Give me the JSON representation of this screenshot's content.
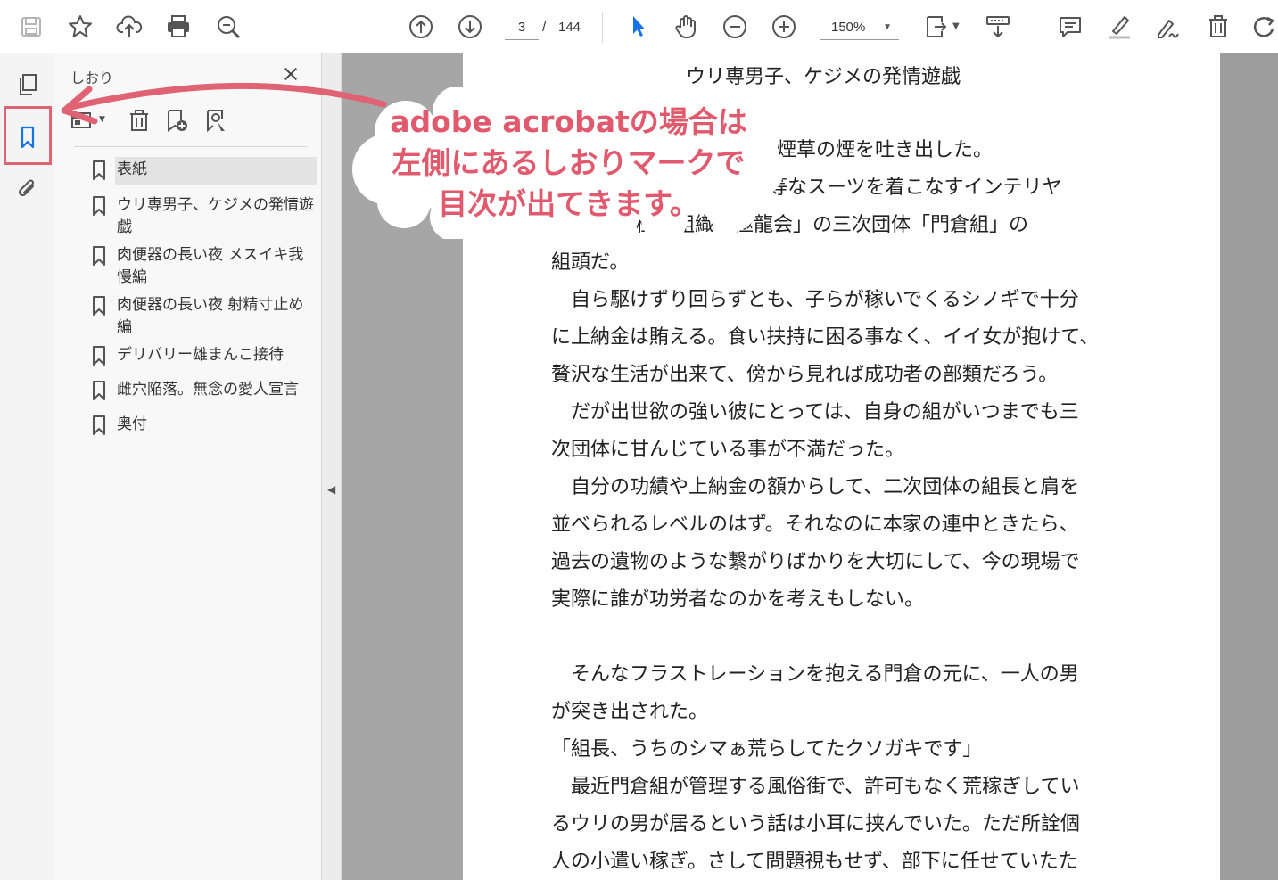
{
  "toolbar": {
    "current_page": "3",
    "page_separator": "/",
    "total_pages": "144",
    "zoom": "150%",
    "icons": [
      "save-icon",
      "star-icon",
      "upload-icon",
      "print-icon",
      "zoom-search-icon",
      "page-up-icon",
      "page-down-icon",
      "select-arrow-icon",
      "hand-icon",
      "zoom-out-icon",
      "zoom-in-icon",
      "fit-page-icon",
      "scroll-mode-icon",
      "comment-icon",
      "highlight-icon",
      "sign-icon",
      "delete-icon",
      "rotate-icon"
    ]
  },
  "bookmarks_panel": {
    "title": "しおり",
    "items": [
      {
        "label": "表紙",
        "selected": true
      },
      {
        "label": "ウリ専男子、ケジメの発情遊戯"
      },
      {
        "label": "肉便器の長い夜 メスイキ我慢編"
      },
      {
        "label": "肉便器の長い夜 射精寸止め編"
      },
      {
        "label": "デリバリー雄まんこ接待"
      },
      {
        "label": "雌穴陥落。無念の愛人宣言"
      },
      {
        "label": "奥付"
      }
    ]
  },
  "document": {
    "header": "ウリ専男子、ケジメの発情遊戯",
    "lines": [
      "煙草の煙を吐き出した。",
      "上等なスーツを着こなすインテリヤ",
      "極道組織「極龍会」の三次団体「門倉組」の",
      "組頭だ。",
      "　自ら駆けずり回らずとも、子らが稼いでくるシノギで十分",
      "に上納金は賄える。食い扶持に困る事なく、イイ女が抱けて、",
      "贅沢な生活が出来て、傍から見れば成功者の部類だろう。",
      "　だが出世欲の強い彼にとっては、自身の組がいつまでも三",
      "次団体に甘んじている事が不満だった。",
      "　自分の功績や上納金の額からして、二次団体の組長と肩を",
      "並べられるレベルのはず。それなのに本家の連中ときたら、",
      "過去の遺物のような繋がりばかりを大切にして、今の現場で",
      "実際に誰が功労者なのかを考えもしない。",
      "",
      "　そんなフラストレーションを抱える門倉の元に、一人の男",
      "が突き出された。",
      "「組長、うちのシマぁ荒らしてたクソガキです」",
      "　最近門倉組が管理する風俗街で、許可もなく荒稼ぎしてい",
      "るウリの男が居るという話は小耳に挟んでいた。ただ所詮個",
      "人の小遣い稼ぎ。さして問題視もせず、部下に任せていたた"
    ]
  },
  "callout": {
    "line1": "adobe acrobatの場合は",
    "line2": "左側にあるしおりマークで",
    "line3": "目次が出てきます。"
  },
  "colors": {
    "accent_callout": "#e0596c",
    "acrobat_blue": "#1473e6"
  }
}
